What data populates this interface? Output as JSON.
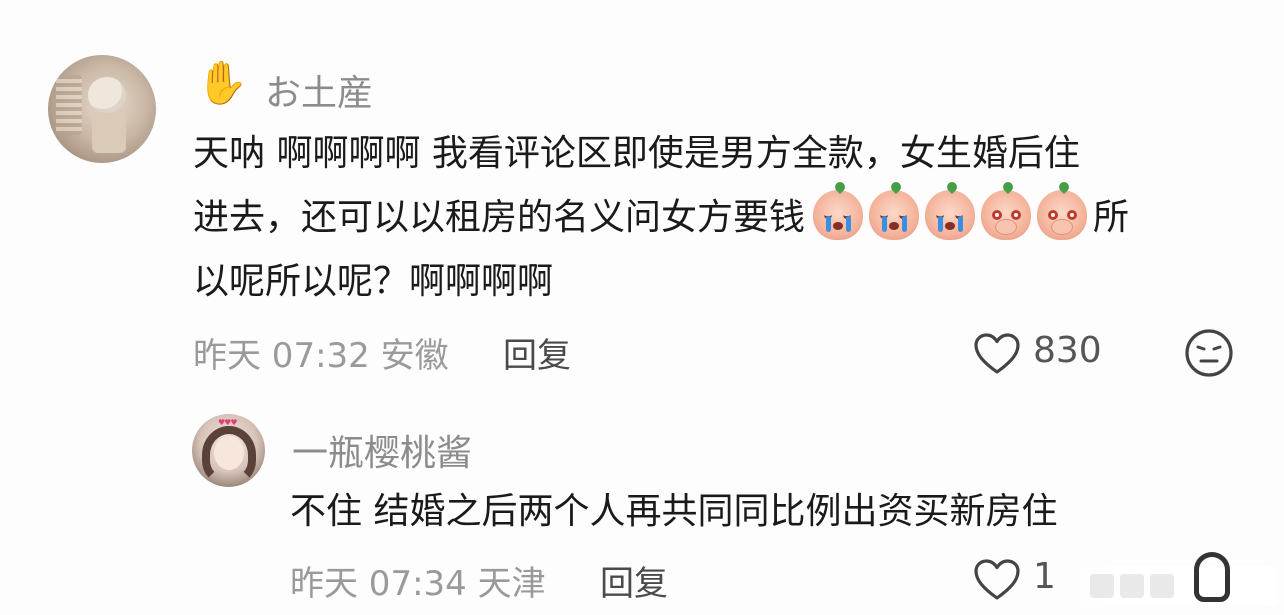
{
  "comment": {
    "username": "お土産",
    "badge_icon": "raised-hand-icon",
    "badge_glyph": "✋",
    "text_line1": "天呐 啊啊啊啊 我看评论区即使是男方全款，女生婚后住",
    "text_line2": "进去，还可以以租房的名义问女方要钱",
    "text_line2_tail": "所",
    "text_line3": "以呢所以呢？啊啊啊啊",
    "emojis": [
      "crying-peach-icon",
      "crying-peach-icon",
      "crying-peach-icon",
      "shy-peach-icon",
      "shy-peach-icon"
    ],
    "time": "昨天 07:32",
    "location": "安徽",
    "reply_label": "回复",
    "likes": "830"
  },
  "reply": {
    "username": "一瓶樱桃酱",
    "text": "不住 结婚之后两个人再共同同比例出资买新房住",
    "time": "昨天 07:34",
    "location": "天津",
    "reply_label": "回复",
    "likes": "1"
  },
  "colors": {
    "text": "#1a1a1a",
    "meta": "#9a9a9a",
    "username": "#8c8c8c"
  }
}
